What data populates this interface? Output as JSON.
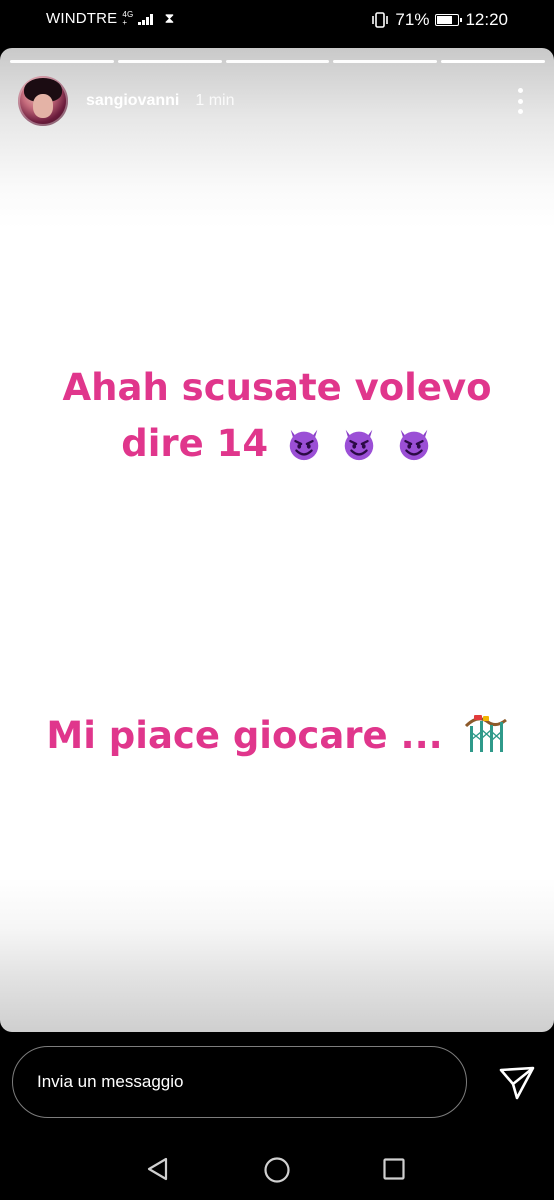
{
  "status_bar": {
    "carrier": "WINDTRE",
    "network_top": "4G",
    "network_bottom": "+",
    "battery_percent": "71%",
    "time": "12:20",
    "icons": [
      "signal-icon",
      "hourglass-icon",
      "vibrate-icon",
      "battery-icon"
    ]
  },
  "story": {
    "progress_segments": 5,
    "username": "sangiovanni",
    "time_ago": "1 min",
    "text_line_1": "Ahah scusate volevo",
    "text_line_2": "dire 14",
    "text_line_3": "Mi piace giocare ...",
    "emojis": [
      "smiling-devil-emoji",
      "smiling-devil-emoji",
      "smiling-devil-emoji",
      "roller-coaster-emoji"
    ],
    "text_color": "#e0368c"
  },
  "reply": {
    "placeholder": "Invia un messaggio"
  },
  "nav": {
    "icons": [
      "back-icon",
      "home-icon",
      "recents-icon"
    ]
  }
}
